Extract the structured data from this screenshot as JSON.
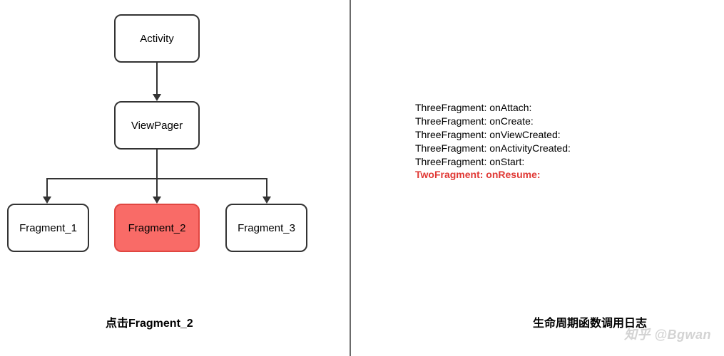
{
  "diagram": {
    "nodes": {
      "activity": "Activity",
      "viewpager": "ViewPager",
      "fragment1": "Fragment_1",
      "fragment2": "Fragment_2",
      "fragment3": "Fragment_3"
    },
    "caption_left": "点击Fragment_2",
    "caption_right": "生命周期函数调用日志"
  },
  "log": {
    "lines": [
      {
        "text": "ThreeFragment: onAttach:",
        "highlight": false
      },
      {
        "text": "ThreeFragment: onCreate:",
        "highlight": false
      },
      {
        "text": "ThreeFragment: onViewCreated:",
        "highlight": false
      },
      {
        "text": "ThreeFragment: onActivityCreated:",
        "highlight": false
      },
      {
        "text": "ThreeFragment: onStart:",
        "highlight": false
      },
      {
        "text": "TwoFragment: onResume:",
        "highlight": true
      }
    ]
  },
  "watermark": "知乎 @Bgwan"
}
